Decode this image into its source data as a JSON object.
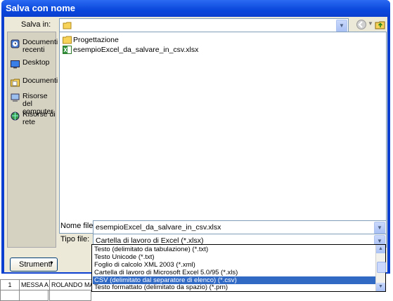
{
  "dialog": {
    "title": "Salva con nome",
    "save_in_label": "Salva in:",
    "places": [
      {
        "label": "Documenti recenti",
        "icon": "recent-documents-icon"
      },
      {
        "label": "Desktop",
        "icon": "desktop-icon"
      },
      {
        "label": "Documenti",
        "icon": "documents-icon"
      },
      {
        "label": "Risorse del computer",
        "icon": "my-computer-icon"
      },
      {
        "label": "Risorse di rete",
        "icon": "network-icon"
      }
    ],
    "files": [
      {
        "name": "Progettazione",
        "icon": "folder-icon"
      },
      {
        "name": "esempioExcel_da_salvare_in_csv.xlsx",
        "icon": "excel-file-icon"
      }
    ],
    "file_name_label": "Nome file:",
    "file_name_value": "esempioExcel_da_salvare_in_csv.xlsx",
    "file_type_label": "Tipo file:",
    "file_type_value": "Cartella di lavoro di Excel (*.xlsx)",
    "file_type_options": [
      "Testo (delimitato da tabulazione) (*.txt)",
      "Testo Unicode (*.txt)",
      "Foglio di calcolo XML 2003 (*.xml)",
      "Cartella di lavoro di Microsoft Excel 5.0/95 (*.xls)",
      "CSV (delimitato dal separatore di elenco) (*.csv)",
      "Testo formattato (delimitato da spazio) (*.prn)"
    ],
    "selected_option_index": 4,
    "tools_label": "Strumenti"
  },
  "sheet": {
    "row_number": "1",
    "cells": [
      "MESSA A I",
      "ROLANDO MAUR"
    ]
  },
  "colors": {
    "title_bar": "#0a3fd0",
    "selection": "#316ac5",
    "dialog_bg": "#ece9d8"
  }
}
